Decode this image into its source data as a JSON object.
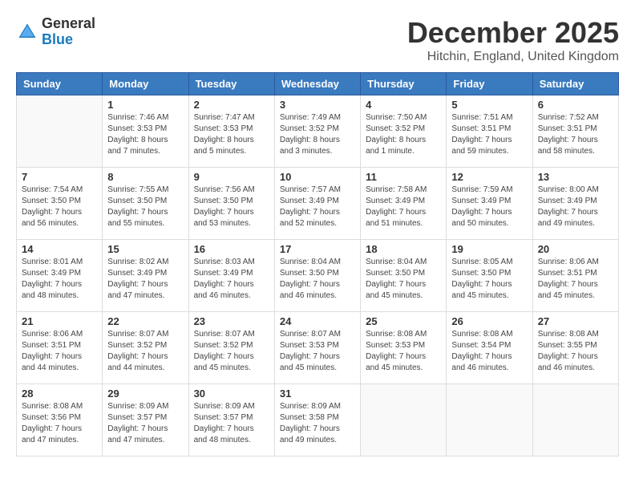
{
  "logo": {
    "general": "General",
    "blue": "Blue"
  },
  "title": "December 2025",
  "subtitle": "Hitchin, England, United Kingdom",
  "calendar": {
    "headers": [
      "Sunday",
      "Monday",
      "Tuesday",
      "Wednesday",
      "Thursday",
      "Friday",
      "Saturday"
    ],
    "weeks": [
      [
        {
          "day": "",
          "info": ""
        },
        {
          "day": "1",
          "info": "Sunrise: 7:46 AM\nSunset: 3:53 PM\nDaylight: 8 hours\nand 7 minutes."
        },
        {
          "day": "2",
          "info": "Sunrise: 7:47 AM\nSunset: 3:53 PM\nDaylight: 8 hours\nand 5 minutes."
        },
        {
          "day": "3",
          "info": "Sunrise: 7:49 AM\nSunset: 3:52 PM\nDaylight: 8 hours\nand 3 minutes."
        },
        {
          "day": "4",
          "info": "Sunrise: 7:50 AM\nSunset: 3:52 PM\nDaylight: 8 hours\nand 1 minute."
        },
        {
          "day": "5",
          "info": "Sunrise: 7:51 AM\nSunset: 3:51 PM\nDaylight: 7 hours\nand 59 minutes."
        },
        {
          "day": "6",
          "info": "Sunrise: 7:52 AM\nSunset: 3:51 PM\nDaylight: 7 hours\nand 58 minutes."
        }
      ],
      [
        {
          "day": "7",
          "info": "Sunrise: 7:54 AM\nSunset: 3:50 PM\nDaylight: 7 hours\nand 56 minutes."
        },
        {
          "day": "8",
          "info": "Sunrise: 7:55 AM\nSunset: 3:50 PM\nDaylight: 7 hours\nand 55 minutes."
        },
        {
          "day": "9",
          "info": "Sunrise: 7:56 AM\nSunset: 3:50 PM\nDaylight: 7 hours\nand 53 minutes."
        },
        {
          "day": "10",
          "info": "Sunrise: 7:57 AM\nSunset: 3:49 PM\nDaylight: 7 hours\nand 52 minutes."
        },
        {
          "day": "11",
          "info": "Sunrise: 7:58 AM\nSunset: 3:49 PM\nDaylight: 7 hours\nand 51 minutes."
        },
        {
          "day": "12",
          "info": "Sunrise: 7:59 AM\nSunset: 3:49 PM\nDaylight: 7 hours\nand 50 minutes."
        },
        {
          "day": "13",
          "info": "Sunrise: 8:00 AM\nSunset: 3:49 PM\nDaylight: 7 hours\nand 49 minutes."
        }
      ],
      [
        {
          "day": "14",
          "info": "Sunrise: 8:01 AM\nSunset: 3:49 PM\nDaylight: 7 hours\nand 48 minutes."
        },
        {
          "day": "15",
          "info": "Sunrise: 8:02 AM\nSunset: 3:49 PM\nDaylight: 7 hours\nand 47 minutes."
        },
        {
          "day": "16",
          "info": "Sunrise: 8:03 AM\nSunset: 3:49 PM\nDaylight: 7 hours\nand 46 minutes."
        },
        {
          "day": "17",
          "info": "Sunrise: 8:04 AM\nSunset: 3:50 PM\nDaylight: 7 hours\nand 46 minutes."
        },
        {
          "day": "18",
          "info": "Sunrise: 8:04 AM\nSunset: 3:50 PM\nDaylight: 7 hours\nand 45 minutes."
        },
        {
          "day": "19",
          "info": "Sunrise: 8:05 AM\nSunset: 3:50 PM\nDaylight: 7 hours\nand 45 minutes."
        },
        {
          "day": "20",
          "info": "Sunrise: 8:06 AM\nSunset: 3:51 PM\nDaylight: 7 hours\nand 45 minutes."
        }
      ],
      [
        {
          "day": "21",
          "info": "Sunrise: 8:06 AM\nSunset: 3:51 PM\nDaylight: 7 hours\nand 44 minutes."
        },
        {
          "day": "22",
          "info": "Sunrise: 8:07 AM\nSunset: 3:52 PM\nDaylight: 7 hours\nand 44 minutes."
        },
        {
          "day": "23",
          "info": "Sunrise: 8:07 AM\nSunset: 3:52 PM\nDaylight: 7 hours\nand 45 minutes."
        },
        {
          "day": "24",
          "info": "Sunrise: 8:07 AM\nSunset: 3:53 PM\nDaylight: 7 hours\nand 45 minutes."
        },
        {
          "day": "25",
          "info": "Sunrise: 8:08 AM\nSunset: 3:53 PM\nDaylight: 7 hours\nand 45 minutes."
        },
        {
          "day": "26",
          "info": "Sunrise: 8:08 AM\nSunset: 3:54 PM\nDaylight: 7 hours\nand 46 minutes."
        },
        {
          "day": "27",
          "info": "Sunrise: 8:08 AM\nSunset: 3:55 PM\nDaylight: 7 hours\nand 46 minutes."
        }
      ],
      [
        {
          "day": "28",
          "info": "Sunrise: 8:08 AM\nSunset: 3:56 PM\nDaylight: 7 hours\nand 47 minutes."
        },
        {
          "day": "29",
          "info": "Sunrise: 8:09 AM\nSunset: 3:57 PM\nDaylight: 7 hours\nand 47 minutes."
        },
        {
          "day": "30",
          "info": "Sunrise: 8:09 AM\nSunset: 3:57 PM\nDaylight: 7 hours\nand 48 minutes."
        },
        {
          "day": "31",
          "info": "Sunrise: 8:09 AM\nSunset: 3:58 PM\nDaylight: 7 hours\nand 49 minutes."
        },
        {
          "day": "",
          "info": ""
        },
        {
          "day": "",
          "info": ""
        },
        {
          "day": "",
          "info": ""
        }
      ]
    ]
  }
}
